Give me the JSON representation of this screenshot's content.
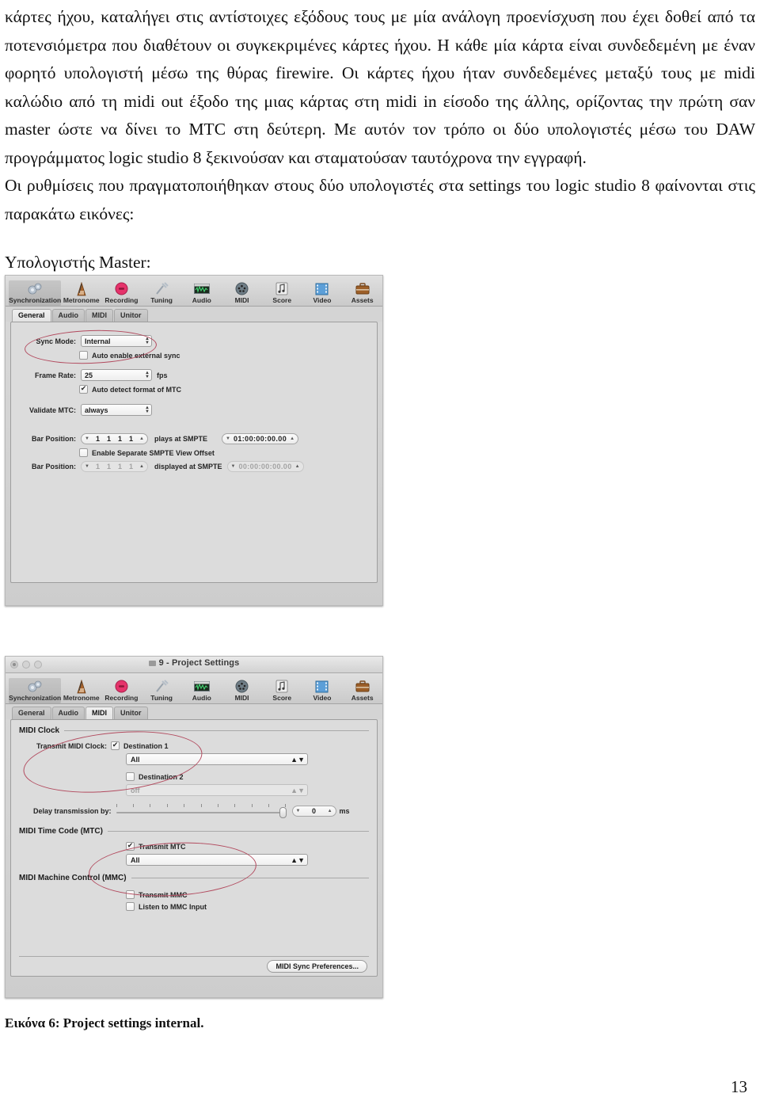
{
  "document": {
    "paragraphs": [
      "κάρτες ήχου, καταλήγει στις αντίστοιχες εξόδους τους με μία ανάλογη προενίσχυση που έχει δοθεί από τα ποτενσιόμετρα που διαθέτουν οι συγκεκριμένες κάρτες ήχου. Η κάθε μία κάρτα είναι συνδεδεμένη με έναν φορητό υπολογιστή μέσω της θύρας firewire. Οι κάρτες ήχου ήταν συνδεδεμένες μεταξύ τους με midi καλώδιο από τη midi out έξοδο της μιας κάρτας στη midi in είσοδο της άλλης, ορίζοντας την πρώτη σαν master ώστε να δίνει το MTC στη δεύτερη. Με αυτόν τον τρόπο οι δύο υπολογιστές μέσω του DAW προγράμματος logic studio 8 ξεκινούσαν και σταματούσαν ταυτόχρονα την εγγραφή.",
      "Οι ρυθμίσεις που πραγματοποιήθηκαν στους δύο υπολογιστές στα settings του logic studio 8 φαίνονται στις παρακάτω εικόνες:"
    ],
    "heading_master": "Υπολογιστής Master:",
    "caption": "Εικόνα 6: Project settings internal.",
    "page_number": "13"
  },
  "toolbar": {
    "items": [
      {
        "label": "Synchronization",
        "icon": "gears-icon"
      },
      {
        "label": "Metronome",
        "icon": "metronome-icon"
      },
      {
        "label": "Recording",
        "icon": "record-icon"
      },
      {
        "label": "Tuning",
        "icon": "tuning-fork-icon"
      },
      {
        "label": "Audio",
        "icon": "waveform-icon"
      },
      {
        "label": "MIDI",
        "icon": "midi-port-icon"
      },
      {
        "label": "Score",
        "icon": "note-page-icon"
      },
      {
        "label": "Video",
        "icon": "filmstrip-icon"
      },
      {
        "label": "Assets",
        "icon": "briefcase-icon"
      }
    ],
    "selected": "Synchronization"
  },
  "tabs": [
    "General",
    "Audio",
    "MIDI",
    "Unitor"
  ],
  "screenshot_general": {
    "selected_tab": "General",
    "sync_mode": {
      "label": "Sync Mode:",
      "value": "Internal"
    },
    "auto_enable_external_sync": {
      "label": "Auto enable external sync",
      "checked": false
    },
    "frame_rate": {
      "label": "Frame Rate:",
      "value": "25",
      "unit": "fps"
    },
    "auto_detect_mtc": {
      "label": "Auto detect format of MTC",
      "checked": true
    },
    "validate_mtc": {
      "label": "Validate MTC:",
      "value": "always"
    },
    "bar_position_plays": {
      "label": "Bar Position:",
      "values": [
        "1",
        "1",
        "1",
        "1"
      ],
      "mid_label": "plays at SMPTE",
      "smpte": "01:00:00:00.00"
    },
    "enable_separate_offset": {
      "label": "Enable Separate SMPTE View Offset",
      "checked": false
    },
    "bar_position_displayed": {
      "label": "Bar Position:",
      "values": [
        "1",
        "1",
        "1",
        "1"
      ],
      "mid_label": "displayed at SMPTE",
      "smpte": "00:00:00:00.00"
    }
  },
  "screenshot_midi": {
    "window_title": "9 - Project Settings",
    "selected_tab": "MIDI",
    "sections": {
      "midi_clock": {
        "title": "MIDI Clock",
        "transmit_label": "Transmit MIDI Clock:",
        "destination1": {
          "label": "Destination 1",
          "checked": true,
          "value": "All"
        },
        "destination2": {
          "label": "Destination 2",
          "checked": false,
          "value": "off"
        },
        "delay": {
          "label": "Delay transmission by:",
          "value": "0",
          "unit": "ms"
        }
      },
      "mtc": {
        "title": "MIDI Time Code (MTC)",
        "transmit_mtc": {
          "label": "Transmit MTC",
          "checked": true
        },
        "destination_value": "All"
      },
      "mmc": {
        "title": "MIDI Machine Control (MMC)",
        "transmit_mmc": {
          "label": "Transmit MMC",
          "checked": false
        },
        "listen_mmc": {
          "label": "Listen to MMC Input",
          "checked": false
        }
      }
    },
    "midi_sync_button": "MIDI Sync Preferences..."
  },
  "colors": {
    "annotation": "#b24a5e",
    "record_red": "#e23a6e",
    "window_bg": "#d4d4d4"
  }
}
